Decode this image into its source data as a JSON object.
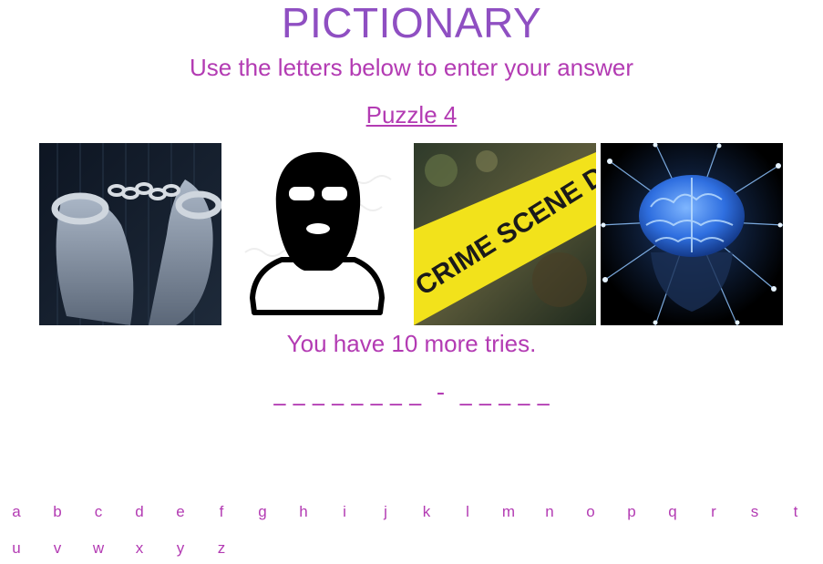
{
  "header": {
    "title": "PICTIONARY",
    "subtitle": "Use the letters below to enter your answer",
    "puzzle_label": "Puzzle 4"
  },
  "images": [
    {
      "icon": "handcuffs-image"
    },
    {
      "icon": "balaclava-mask-icon"
    },
    {
      "icon": "crime-scene-tape-image",
      "text": "CRIME SCENE DO NOT CROSS"
    },
    {
      "icon": "glowing-brain-image"
    }
  ],
  "status": {
    "tries_text": "You have 10 more tries."
  },
  "answer": {
    "display": "_ _ _ _ _ _ _ _  -  _ _ _ _ _"
  },
  "keyboard": {
    "row1": [
      "a",
      "b",
      "c",
      "d",
      "e",
      "f",
      "g",
      "h",
      "i",
      "j",
      "k",
      "l",
      "m",
      "n",
      "o",
      "p",
      "q",
      "r",
      "s",
      "t"
    ],
    "row2": [
      "u",
      "v",
      "w",
      "x",
      "y",
      "z"
    ]
  },
  "colors": {
    "title": "#8f4fc2",
    "text": "#b33bb3",
    "tape": "#f2e21b"
  }
}
